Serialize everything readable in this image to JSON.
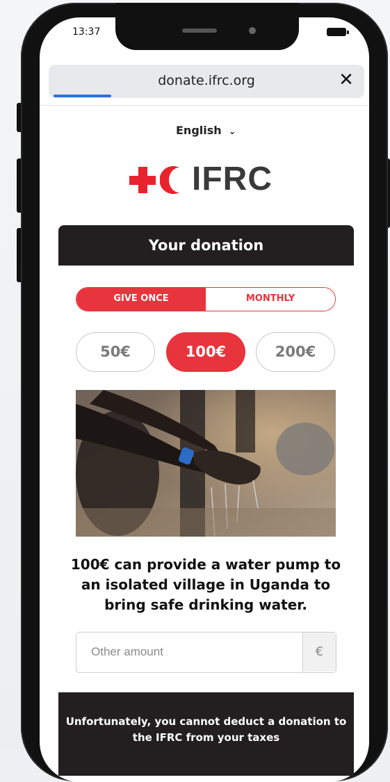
{
  "status": {
    "time": "13:37"
  },
  "browser": {
    "url": "donate.ifrc.org",
    "close_label": "✕"
  },
  "language": {
    "selected": "English"
  },
  "logo": {
    "text": "IFRC"
  },
  "donation": {
    "heading": "Your donation",
    "frequency": {
      "once": "GIVE ONCE",
      "monthly": "MONTHLY",
      "selected": "GIVE ONCE"
    },
    "amounts": [
      "50€",
      "100€",
      "200€"
    ],
    "selected_amount": "100€",
    "impact_text": "100€ can provide a water pump to an isolated village in Uganda to bring safe drinking water.",
    "other_amount": {
      "placeholder": "Other amount",
      "value": "",
      "currency": "€"
    }
  },
  "tax_notice": "Unfortunately, you cannot deduct a donation to the IFRC from your taxes",
  "colors": {
    "brand_red": "#e8343d",
    "dark": "#231f20"
  }
}
